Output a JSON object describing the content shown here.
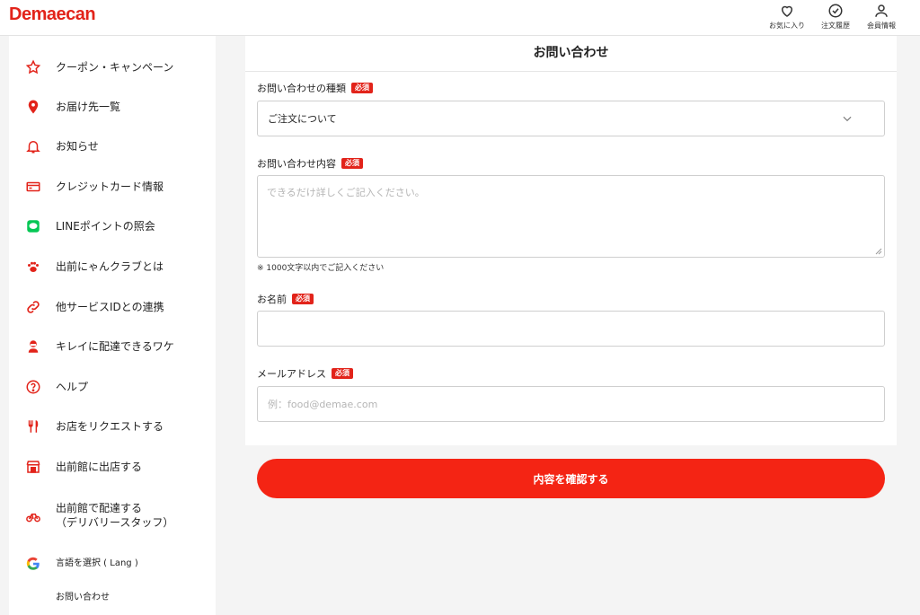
{
  "header": {
    "logo": "Demaecan",
    "nav": [
      {
        "label": "お気に入り",
        "icon": "heart-icon"
      },
      {
        "label": "注文履歴",
        "icon": "check-circle-icon"
      },
      {
        "label": "会員情報",
        "icon": "user-icon"
      }
    ]
  },
  "sidebar": {
    "items": [
      {
        "label": "クーポン・キャンペーン",
        "icon": "star-icon"
      },
      {
        "label": "お届け先一覧",
        "icon": "map-pin-icon"
      },
      {
        "label": "お知らせ",
        "icon": "bell-icon"
      },
      {
        "label": "クレジットカード情報",
        "icon": "credit-card-icon"
      },
      {
        "label": "LINEポイントの照会",
        "icon": "line-icon"
      },
      {
        "label": "出前にゃんクラブとは",
        "icon": "paw-icon"
      },
      {
        "label": "他サービスIDとの連携",
        "icon": "link-icon"
      },
      {
        "label": "キレイに配達できるワケ",
        "icon": "delivery-person-icon"
      },
      {
        "label": "ヘルプ",
        "icon": "question-icon"
      },
      {
        "label": "お店をリクエストする",
        "icon": "fork-knife-icon"
      },
      {
        "label": "出前館に出店する",
        "icon": "store-icon"
      },
      {
        "label": "出前館で配達する",
        "label2": "（デリバリースタッフ）",
        "icon": "bicycle-icon"
      },
      {
        "label": "言語を選択 ( Lang )",
        "icon": "google-icon"
      },
      {
        "label": "お問い合わせ"
      }
    ]
  },
  "form": {
    "title": "お問い合わせ",
    "required_badge": "必須",
    "type_label": "お問い合わせの種類",
    "type_value": "ご注文について",
    "content_label": "お問い合わせ内容",
    "content_placeholder": "できるだけ詳しくご記入ください。",
    "content_hint": "※ 1000文字以内でご記入ください",
    "name_label": "お名前",
    "name_value": "",
    "email_label": "メールアドレス",
    "email_placeholder": "例：food@demae.com",
    "submit_label": "内容を確認する"
  },
  "colors": {
    "brand": "#e2231a",
    "button": "#f42414",
    "line_green": "#06c755"
  }
}
